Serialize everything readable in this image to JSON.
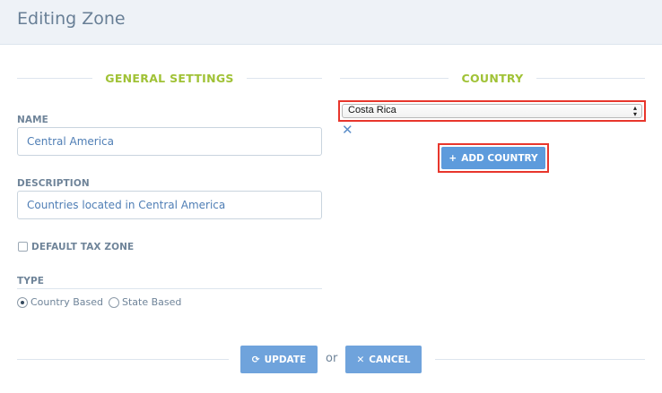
{
  "header": {
    "title": "Editing Zone"
  },
  "general": {
    "section_title": "GENERAL SETTINGS",
    "name_label": "NAME",
    "name_value": "Central America",
    "description_label": "DESCRIPTION",
    "description_value": "Countries located in Central America",
    "default_tax_label": "DEFAULT TAX ZONE",
    "default_tax_checked": false,
    "type_label": "TYPE",
    "type_options": [
      {
        "label": "Country Based",
        "selected": true
      },
      {
        "label": "State Based",
        "selected": false
      }
    ]
  },
  "country": {
    "section_title": "COUNTRY",
    "selected_country": "Costa Rica",
    "remove_icon": "close-icon",
    "add_button_label": "ADD COUNTRY",
    "add_icon": "plus-icon"
  },
  "footer": {
    "update_label": "UPDATE",
    "update_icon": "refresh-icon",
    "or_text": "or",
    "cancel_label": "CANCEL",
    "cancel_icon": "close-icon"
  },
  "colors": {
    "accent_green": "#a0c236",
    "button_blue": "#6fa3dc",
    "highlight_red": "#e8362c"
  }
}
